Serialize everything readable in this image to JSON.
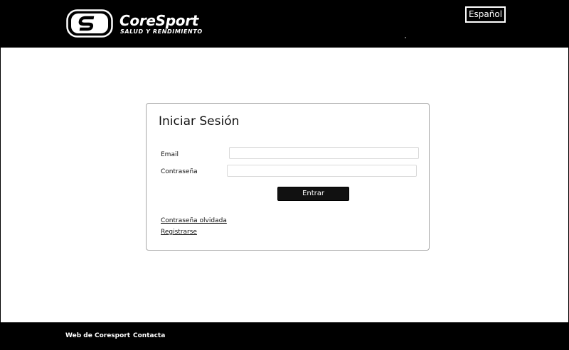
{
  "header": {
    "brand_name": "CoreSport",
    "brand_tagline": "SALUD Y RENDIMIENTO",
    "language_label": "Español"
  },
  "login": {
    "title": "Iniciar Sesión",
    "email_label": "Email",
    "email_value": "",
    "password_label": "Contraseña",
    "password_value": "",
    "submit_label": "Entrar",
    "forgot_password_link": "Contraseña olvidada",
    "register_link": "Registrarse"
  },
  "footer": {
    "links": [
      {
        "label": "Web de Coresport"
      },
      {
        "label": "Contacta"
      }
    ]
  },
  "colors": {
    "header_background": "#000000",
    "footer_background": "#000000",
    "main_background": "#ffffff",
    "button_background": "#111111",
    "card_border": "#a8a8a8"
  }
}
